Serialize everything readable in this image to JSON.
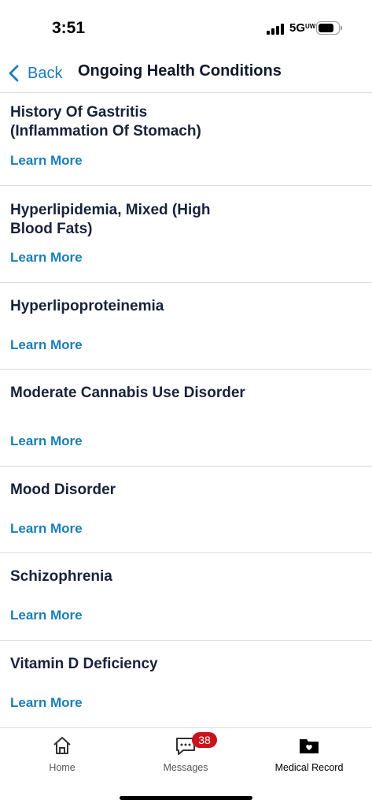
{
  "status_bar": {
    "time": "3:51",
    "network": "5G",
    "network_suffix": "UW"
  },
  "nav": {
    "back_label": "Back",
    "title": "Ongoing Health Conditions"
  },
  "conditions": [
    {
      "name": "History Of Gastritis (Inflammation Of Stomach)",
      "link": "Learn More"
    },
    {
      "name": "Hyperlipidemia, Mixed (High Blood Fats)",
      "link": "Learn More"
    },
    {
      "name": "Hyperlipoproteinemia",
      "link": "Learn More"
    },
    {
      "name": "Moderate Cannabis Use Disorder",
      "link": "Learn More"
    },
    {
      "name": "Mood Disorder",
      "link": "Learn More"
    },
    {
      "name": "Schizophrenia",
      "link": "Learn More"
    },
    {
      "name": "Vitamin D Deficiency",
      "link": "Learn More"
    }
  ],
  "tab_bar": {
    "home_label": "Home",
    "messages_label": "Messages",
    "messages_badge": "38",
    "medical_record_label": "Medical Record",
    "active_tab": "Medical Record"
  },
  "colors": {
    "accent": "#1a7fb5",
    "badge": "#c9141e",
    "text": "#17223b"
  }
}
